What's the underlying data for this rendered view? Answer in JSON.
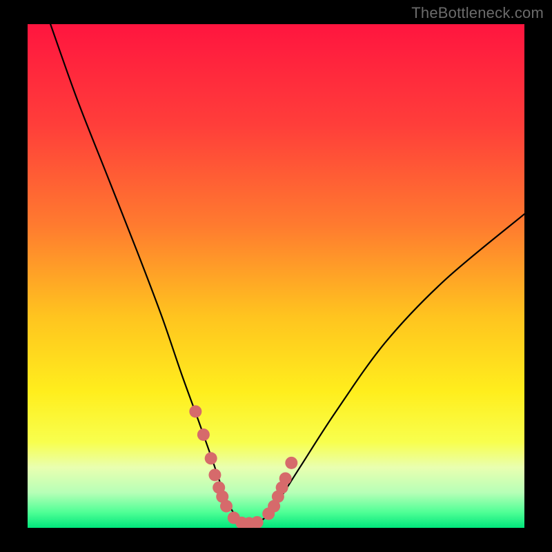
{
  "watermark": "TheBottleneck.com",
  "chart_data": {
    "type": "line",
    "title": "",
    "xlabel": "",
    "ylabel": "",
    "xlim": [
      0,
      100
    ],
    "ylim": [
      0,
      100
    ],
    "grid": false,
    "legend": false,
    "background_gradient": {
      "stops": [
        {
          "offset": 0.0,
          "color": "#ff153f"
        },
        {
          "offset": 0.2,
          "color": "#ff3e3a"
        },
        {
          "offset": 0.4,
          "color": "#ff7b2f"
        },
        {
          "offset": 0.58,
          "color": "#ffc41f"
        },
        {
          "offset": 0.73,
          "color": "#ffee1d"
        },
        {
          "offset": 0.83,
          "color": "#f8ff4e"
        },
        {
          "offset": 0.88,
          "color": "#e9ffb0"
        },
        {
          "offset": 0.93,
          "color": "#b7ffb7"
        },
        {
          "offset": 0.97,
          "color": "#4dff95"
        },
        {
          "offset": 1.0,
          "color": "#00e57b"
        }
      ]
    },
    "series": [
      {
        "name": "bottleneck-curve",
        "x": [
          4.6,
          10,
          16,
          22,
          27,
          31,
          34.5,
          37,
          39,
          40.5,
          42,
          43.5,
          45,
          46.5,
          48,
          50,
          55,
          62,
          72,
          84,
          100
        ],
        "y": [
          100,
          85,
          70,
          55,
          42,
          30.5,
          21,
          14,
          8.3,
          4.6,
          2.3,
          1.2,
          1.0,
          1.2,
          2.2,
          4.6,
          12.3,
          23,
          36.8,
          49.2,
          62.3
        ]
      }
    ],
    "marker_groups": [
      {
        "name": "left-cluster",
        "color": "#d66a6b",
        "points": [
          {
            "x": 33.8,
            "y": 23.1
          },
          {
            "x": 35.4,
            "y": 18.5
          },
          {
            "x": 36.9,
            "y": 13.8
          },
          {
            "x": 37.7,
            "y": 10.5
          },
          {
            "x": 38.5,
            "y": 8.0
          },
          {
            "x": 39.2,
            "y": 6.2
          },
          {
            "x": 40.0,
            "y": 4.3
          },
          {
            "x": 41.5,
            "y": 2.0
          },
          {
            "x": 43.1,
            "y": 1.0
          },
          {
            "x": 44.6,
            "y": 0.9
          },
          {
            "x": 46.2,
            "y": 1.1
          }
        ]
      },
      {
        "name": "right-cluster",
        "color": "#d66a6b",
        "points": [
          {
            "x": 48.5,
            "y": 2.8
          },
          {
            "x": 49.6,
            "y": 4.3
          },
          {
            "x": 50.4,
            "y": 6.2
          },
          {
            "x": 51.2,
            "y": 8.0
          },
          {
            "x": 51.9,
            "y": 9.8
          },
          {
            "x": 53.1,
            "y": 12.9
          }
        ]
      }
    ]
  }
}
